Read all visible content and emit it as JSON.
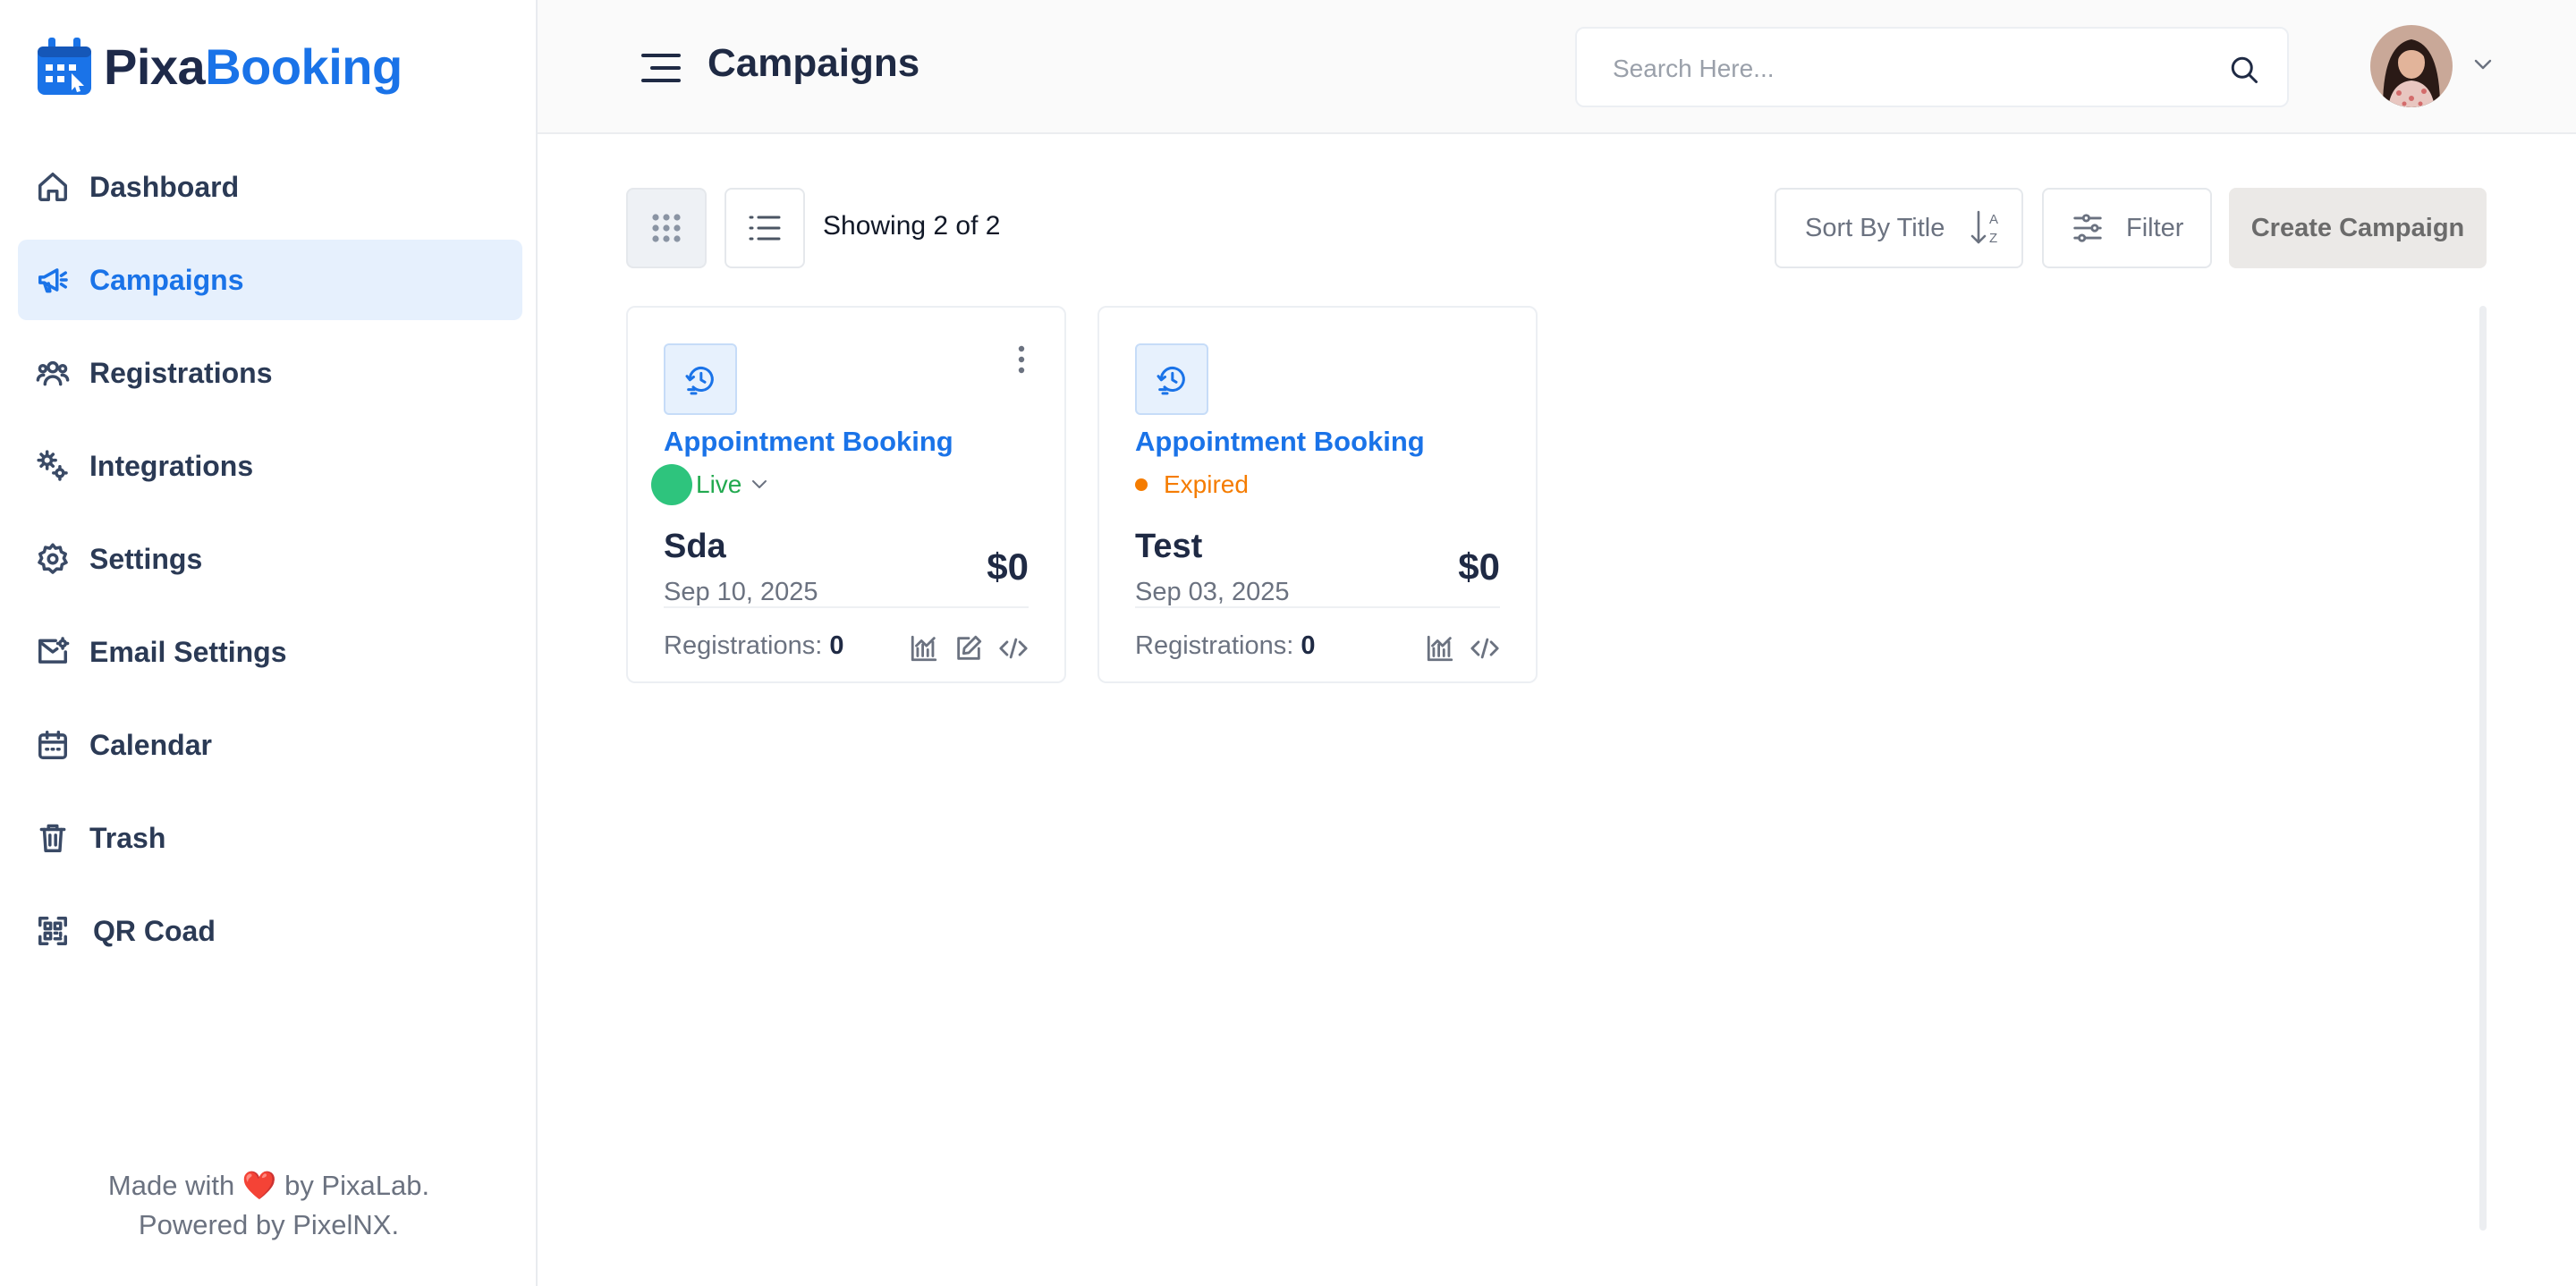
{
  "brand": {
    "part1": "Pixa",
    "part2": "Booking",
    "logo_icon": "calendar-logo-icon"
  },
  "sidebar": {
    "items": [
      {
        "label": "Dashboard",
        "icon": "home-icon",
        "active": false
      },
      {
        "label": "Campaigns",
        "icon": "megaphone-icon",
        "active": true
      },
      {
        "label": "Registrations",
        "icon": "users-icon",
        "active": false
      },
      {
        "label": "Integrations",
        "icon": "integrations-icon",
        "active": false
      },
      {
        "label": "Settings",
        "icon": "gear-icon",
        "active": false
      },
      {
        "label": "Email Settings",
        "icon": "mail-settings-icon",
        "active": false
      },
      {
        "label": "Calendar",
        "icon": "calendar-icon",
        "active": false
      },
      {
        "label": "Trash",
        "icon": "trash-icon",
        "active": false
      },
      {
        "label": "QR Coad",
        "icon": "qr-code-icon",
        "active": false
      }
    ],
    "footer": {
      "made_with": "Made with",
      "by_text": "by PixaLab.",
      "powered": "Powered by PixelNX."
    }
  },
  "header": {
    "title": "Campaigns",
    "search_placeholder": "Search Here..."
  },
  "toolbar": {
    "showing": "Showing 2 of 2",
    "sort_label": "Sort By Title",
    "filter_label": "Filter",
    "create_label": "Create Campaign"
  },
  "campaigns": [
    {
      "type": "Appointment Booking",
      "status": "Live",
      "name": "Sda",
      "date": "Sep 10, 2025",
      "price": "$0",
      "registrations_label": "Registrations:",
      "registrations": "0"
    },
    {
      "type": "Appointment Booking",
      "status": "Expired",
      "name": "Test",
      "date": "Sep 03, 2025",
      "price": "$0",
      "registrations_label": "Registrations:",
      "registrations": "0"
    }
  ],
  "colors": {
    "accent": "#1a73e8",
    "active_bg": "#e6f0fd",
    "live": "#22a94f",
    "expired": "#f57c00"
  }
}
